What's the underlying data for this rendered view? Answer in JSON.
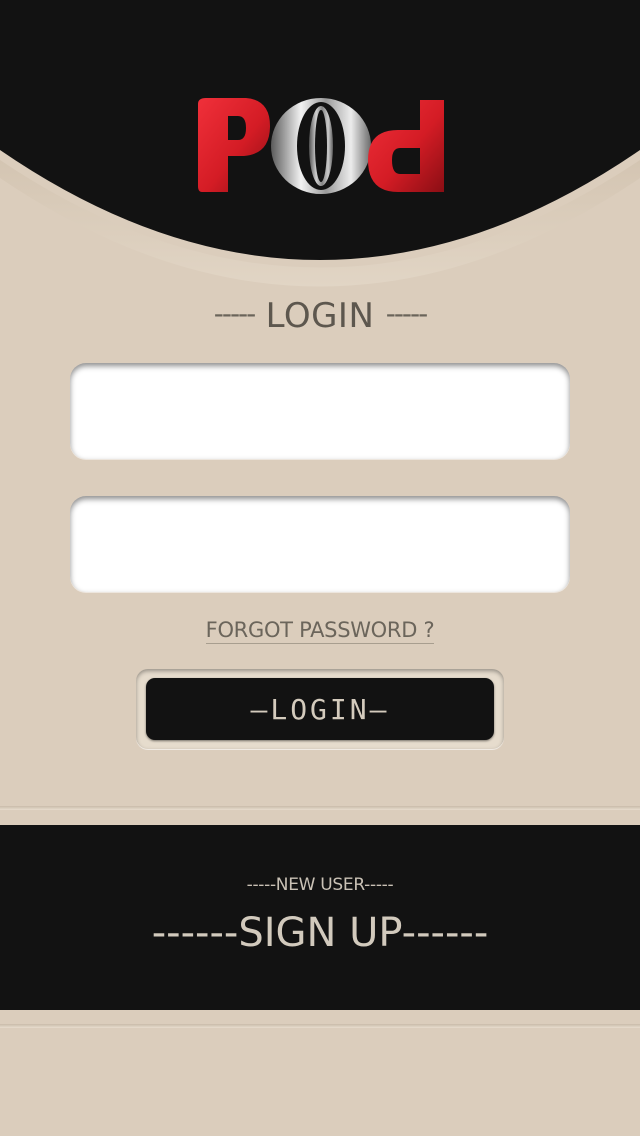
{
  "header": {
    "logo_text": "POd",
    "logo_alt": "pod-logo"
  },
  "login_section": {
    "heading_left_dash": "-----",
    "heading": "LOGIN",
    "heading_right_dash": "-----"
  },
  "form": {
    "username_value": "",
    "username_placeholder": "",
    "password_value": "",
    "password_placeholder": ""
  },
  "forgot_password": "FORGOT PASSWORD ?",
  "login_button": "—LOGIN—",
  "footer": {
    "new_user": "-----NEW USER-----",
    "sign_up": "------SIGN UP------"
  },
  "colors": {
    "background": "#dbcdbc",
    "dark": "#121212",
    "logo_red": "#e0222c",
    "logo_silver": "#cfcfcf",
    "text_muted": "#5d574e"
  },
  "icons": [
    "pod-logo"
  ]
}
